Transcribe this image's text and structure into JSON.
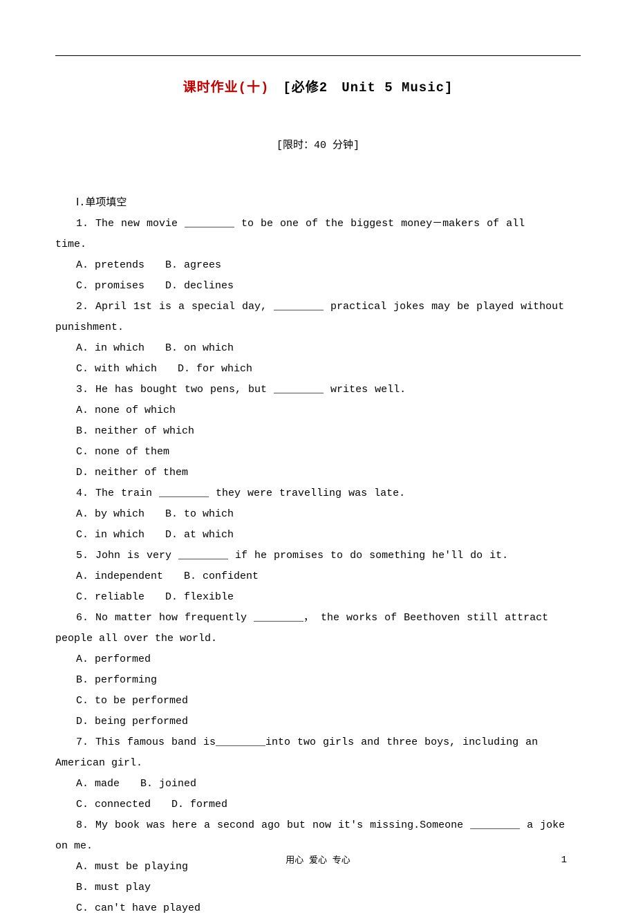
{
  "title": {
    "zh": "课时作业(十)　",
    "en": "[必修2　Unit 5 Music]"
  },
  "time_limit": "[限时：40 分钟]",
  "section1": "Ⅰ.单项填空",
  "questions": [
    {
      "n": "1",
      "stem_a": "1. The new movie ________ to be one of the biggest money－makers of all",
      "stem_b": "time.",
      "opt1": "A. pretends　　B. agrees",
      "opt2": "C. promises　　D. declines"
    },
    {
      "n": "2",
      "stem_a": "2. April 1st is a special day, ________ practical jokes may be played without",
      "stem_b": "punishment.",
      "opt1": "A. in which　　B. on which",
      "opt2": "C. with which　　D. for which"
    },
    {
      "n": "3",
      "stem_a": "3. He has bought two pens, but ________ writes well.",
      "opt1": "A. none of which",
      "opt2": "B. neither of which",
      "opt3": "C. none of them",
      "opt4": "D. neither of them"
    },
    {
      "n": "4",
      "stem_a": "4. The train ________ they were travelling was late.",
      "opt1": "A. by which　　B. to which",
      "opt2": "C. in which　　D. at which"
    },
    {
      "n": "5",
      "stem_a": "5. John is very ________ if he promises to do something he'll do it.",
      "opt1": "A. independent　　B. confident",
      "opt2": "C. reliable　　D. flexible"
    },
    {
      "n": "6",
      "stem_a": "6. No matter how frequently ________，  the works of Beethoven still attract",
      "stem_b": "people all over the world.",
      "opt1": "A. performed",
      "opt2": "B. performing",
      "opt3": "C. to be performed",
      "opt4": "D. being performed"
    },
    {
      "n": "7",
      "stem_a": "7. This famous band is________into two girls and three boys, including an",
      "stem_b": "American girl.",
      "opt1": "A. made　　B. joined",
      "opt2": "C. connected　　D. formed"
    },
    {
      "n": "8",
      "stem_a": "8. My book was here a second ago but now it's missing.Someone ________ a joke",
      "stem_b": "on me.",
      "opt1": "A. must be playing",
      "opt2": "B. must play",
      "opt3": "C. can't have played"
    }
  ],
  "footer": "用心 爱心 专心",
  "page_num": "1"
}
